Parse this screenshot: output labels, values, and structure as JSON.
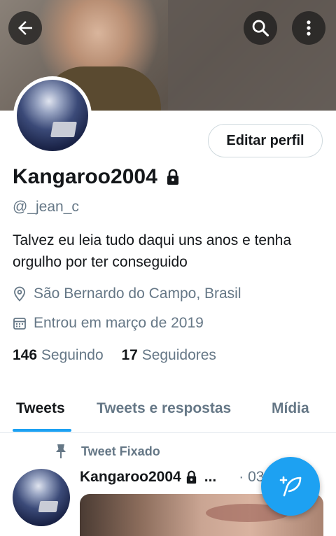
{
  "profile": {
    "display_name": "Kangaroo2004",
    "handle": "@_jean_c",
    "bio": "Talvez eu leia tudo daqui uns anos e tenha orgulho por ter conseguido",
    "location": "São Bernardo do Campo, Brasil",
    "joined": "Entrou em março de 2019",
    "following_count": "146",
    "following_label": "Seguindo",
    "followers_count": "17",
    "followers_label": "Seguidores",
    "protected_icon": "lock-icon"
  },
  "header": {
    "back_icon": "arrow-left-icon",
    "search_icon": "search-icon",
    "more_icon": "more-vertical-icon",
    "edit_label": "Editar perfil"
  },
  "tabs": [
    {
      "label": "Tweets",
      "active": true
    },
    {
      "label": "Tweets e respostas",
      "active": false
    },
    {
      "label": "Mídia",
      "active": false
    }
  ],
  "pinned_tweet": {
    "pinned_label": "Tweet Fixado",
    "author": "Kangaroo2004",
    "ellipsis": "...",
    "time": "· 03 s"
  },
  "fab": {
    "icon": "compose-feather-icon"
  },
  "colors": {
    "accent": "#1da1f2",
    "secondary_text": "#657786",
    "primary_text": "#14171a"
  }
}
